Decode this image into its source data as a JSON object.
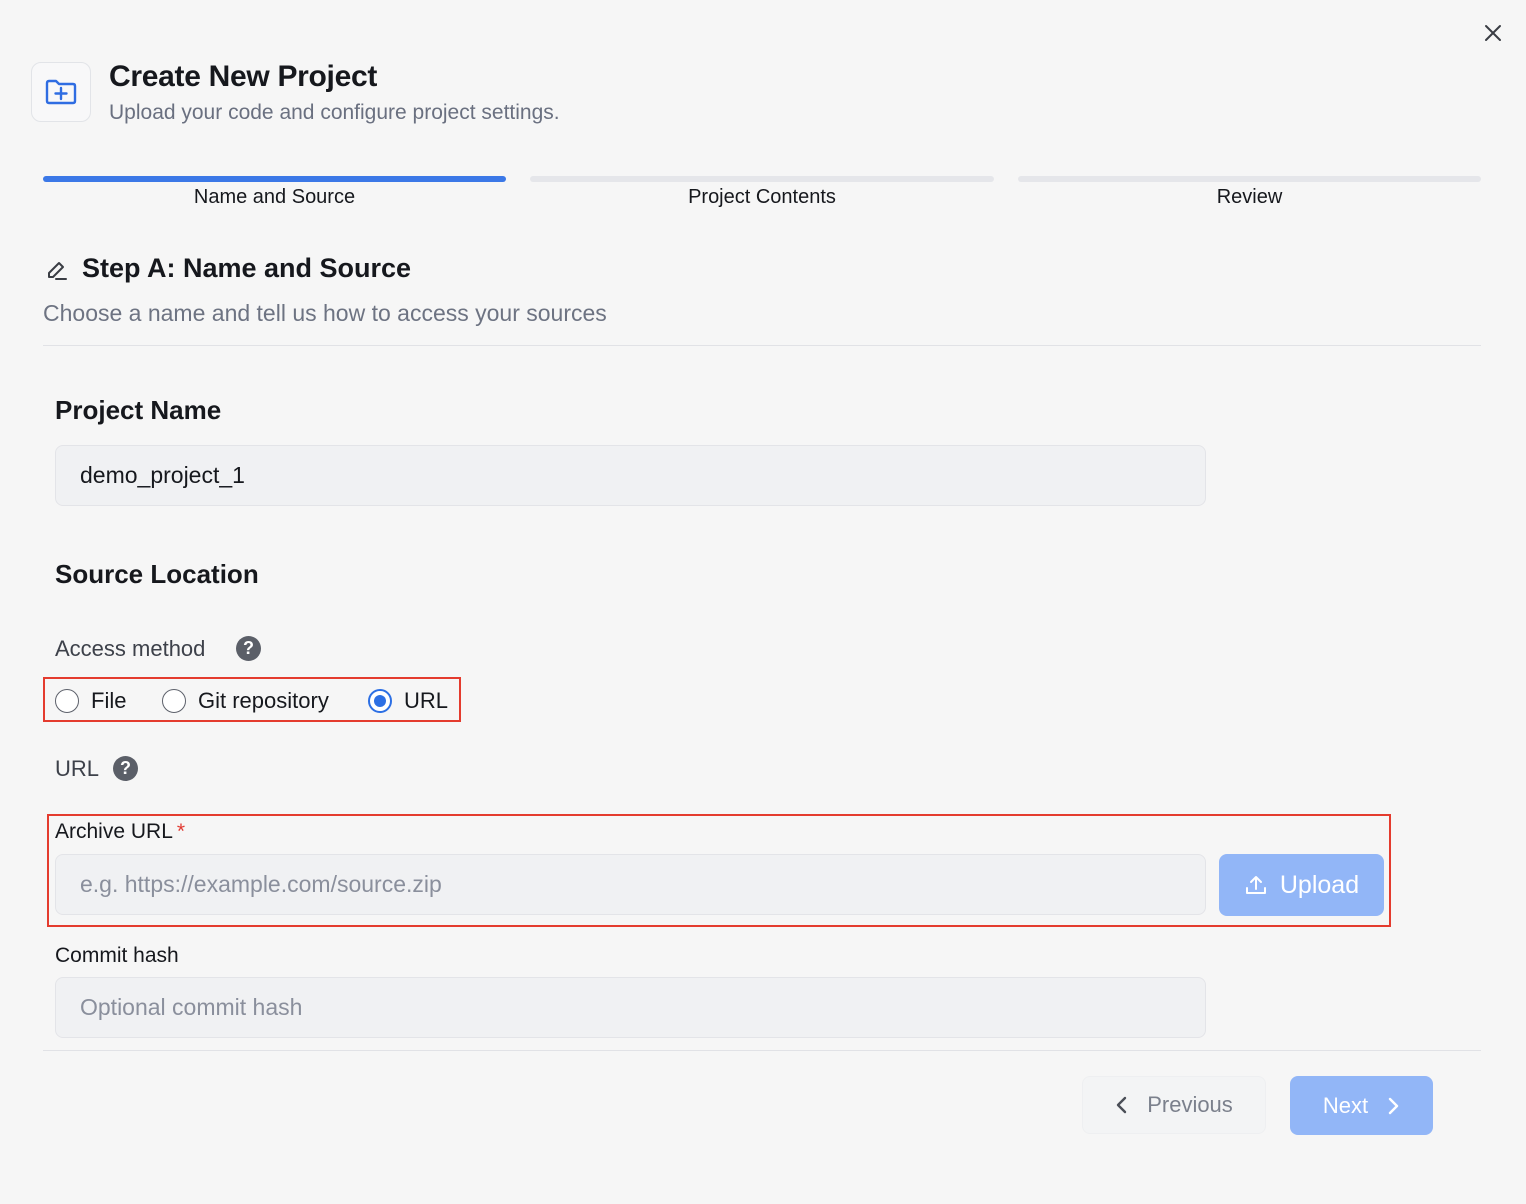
{
  "dialog": {
    "title": "Create New Project",
    "subtitle": "Upload your code and configure project settings.",
    "header_icon": "folder-plus-icon",
    "close_icon": "close-icon"
  },
  "steps": [
    {
      "label": "Name and Source",
      "active": true
    },
    {
      "label": "Project Contents",
      "active": false
    },
    {
      "label": "Review",
      "active": false
    }
  ],
  "section": {
    "icon": "edit-pencil-icon",
    "title": "Step A: Name and Source",
    "description": "Choose a name and tell us how to access your sources"
  },
  "project_name": {
    "label": "Project Name",
    "value": "demo_project_1"
  },
  "source_location": {
    "label": "Source Location",
    "access_method_label": "Access method",
    "options": [
      {
        "label": "File",
        "checked": false
      },
      {
        "label": "Git repository",
        "checked": false
      },
      {
        "label": "URL",
        "checked": true
      }
    ],
    "url_label": "URL",
    "archive_url_label": "Archive URL",
    "required_mark": "*",
    "archive_url_placeholder": "e.g. https://example.com/source.zip",
    "archive_url_value": "",
    "upload_label": "Upload",
    "commit_hash_label": "Commit hash",
    "commit_hash_placeholder": "Optional commit hash",
    "commit_hash_value": ""
  },
  "footer": {
    "previous_label": "Previous",
    "next_label": "Next"
  },
  "colors": {
    "accent": "#3b78e7",
    "accent_disabled": "#92b6f7",
    "highlight_border": "#e43b2e"
  }
}
